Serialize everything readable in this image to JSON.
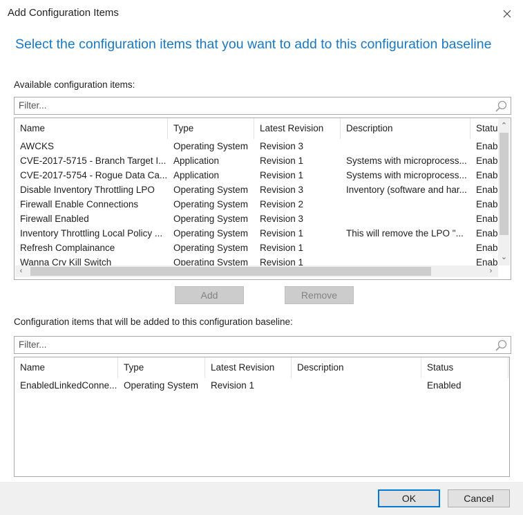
{
  "window": {
    "title": "Add Configuration Items",
    "close_label": "✕"
  },
  "heading": "Select the configuration items that you want to add to this configuration baseline",
  "available": {
    "label": "Available configuration items:",
    "filter_placeholder": "Filter...",
    "columns": [
      "Name",
      "Type",
      "Latest Revision",
      "Description",
      "Statu"
    ],
    "rows": [
      [
        "AWCKS",
        "Operating System",
        "Revision 3",
        "",
        "Enab"
      ],
      [
        "CVE-2017-5715 - Branch Target I...",
        "Application",
        "Revision 1",
        "Systems with microprocess...",
        "Enab"
      ],
      [
        "CVE-2017-5754 - Rogue Data Ca...",
        "Application",
        "Revision 1",
        "Systems with microprocess...",
        "Enab"
      ],
      [
        "Disable Inventory Throttling LPO",
        "Operating System",
        "Revision 3",
        "Inventory (software and har...",
        "Enab"
      ],
      [
        "Firewall Enable Connections",
        "Operating System",
        "Revision 2",
        "",
        "Enab"
      ],
      [
        "Firewall Enabled",
        "Operating System",
        "Revision 3",
        "",
        "Enab"
      ],
      [
        "Inventory Throttling Local Policy ...",
        "Operating System",
        "Revision 1",
        "This will remove the LPO \"...",
        "Enab"
      ],
      [
        "Refresh Complainance",
        "Operating System",
        "Revision 1",
        "",
        "Enab"
      ],
      [
        "Wanna Cry Kill Switch",
        "Operating System",
        "Revision 1",
        "",
        "Enab"
      ]
    ]
  },
  "buttons": {
    "add": "Add",
    "remove": "Remove",
    "ok": "OK",
    "cancel": "Cancel"
  },
  "selected": {
    "label": "Configuration items that will be added to this configuration baseline:",
    "filter_placeholder": "Filter...",
    "columns": [
      "Name",
      "Type",
      "Latest Revision",
      "Description",
      "Status"
    ],
    "rows": [
      [
        "EnabledLinkedConne...",
        "Operating System",
        "Revision 1",
        "",
        "Enabled"
      ]
    ]
  },
  "colors": {
    "heading": "#1a78c2",
    "ok_border": "#0078d7"
  }
}
